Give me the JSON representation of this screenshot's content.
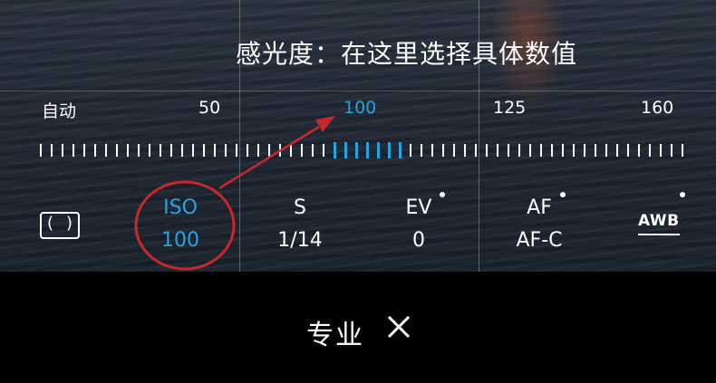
{
  "annotation": "感光度：在这里选择具体数值",
  "scale": {
    "labels": [
      "自动",
      "50",
      "100",
      "125",
      "160"
    ],
    "selected": "100"
  },
  "controls": {
    "metering_glyph": "( )",
    "iso": {
      "name": "ISO",
      "value": "100"
    },
    "shutter": {
      "name": "S",
      "value": "1/14"
    },
    "ev": {
      "name": "EV",
      "value": "0"
    },
    "af": {
      "name": "AF",
      "value": "AF-C"
    },
    "awb": {
      "name": "AWB"
    }
  },
  "mode": {
    "label": "专业",
    "close_icon": "close-icon"
  },
  "colors": {
    "accent": "#27a3e0",
    "annotation_red": "#c8282a"
  }
}
